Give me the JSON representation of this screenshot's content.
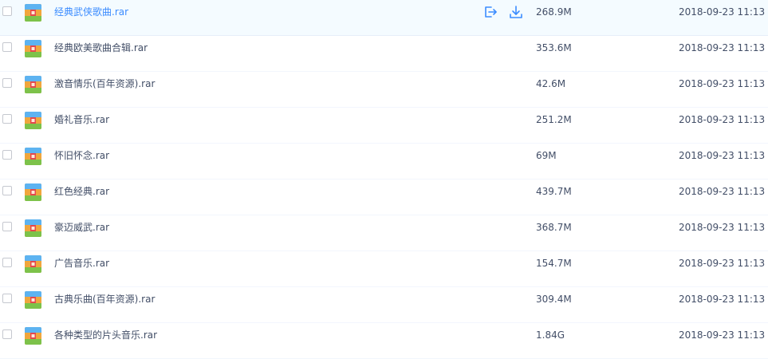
{
  "files": [
    {
      "name": "经典武侠歌曲.rar",
      "size": "268.9M",
      "date": "2018-09-23 11:13",
      "icon": "rar-archive-icon",
      "hovered": true
    },
    {
      "name": "经典欧美歌曲合辑.rar",
      "size": "353.6M",
      "date": "2018-09-23 11:13",
      "icon": "rar-archive-icon"
    },
    {
      "name": "激音情乐(百年资源).rar",
      "size": "42.6M",
      "date": "2018-09-23 11:13",
      "icon": "rar-archive-icon"
    },
    {
      "name": "婚礼音乐.rar",
      "size": "251.2M",
      "date": "2018-09-23 11:13",
      "icon": "rar-archive-icon"
    },
    {
      "name": "怀旧怀念.rar",
      "size": "69M",
      "date": "2018-09-23 11:13",
      "icon": "rar-archive-icon"
    },
    {
      "name": "红色经典.rar",
      "size": "439.7M",
      "date": "2018-09-23 11:13",
      "icon": "rar-archive-icon"
    },
    {
      "name": "豪迈威武.rar",
      "size": "368.7M",
      "date": "2018-09-23 11:13",
      "icon": "rar-archive-icon"
    },
    {
      "name": "广告音乐.rar",
      "size": "154.7M",
      "date": "2018-09-23 11:13",
      "icon": "rar-archive-icon"
    },
    {
      "name": "古典乐曲(百年资源).rar",
      "size": "309.4M",
      "date": "2018-09-23 11:13",
      "icon": "rar-archive-icon"
    },
    {
      "name": "各种类型的片头音乐.rar",
      "size": "1.84G",
      "date": "2018-09-23 11:13",
      "icon": "rar-archive-icon"
    }
  ],
  "row_actions": {
    "share_icon": "share-icon",
    "download_icon": "download-icon"
  },
  "colors": {
    "accent": "#3b8cff",
    "text": "#424e67",
    "hover_bg": "#f4fbff",
    "divider": "#f2f6fd"
  }
}
